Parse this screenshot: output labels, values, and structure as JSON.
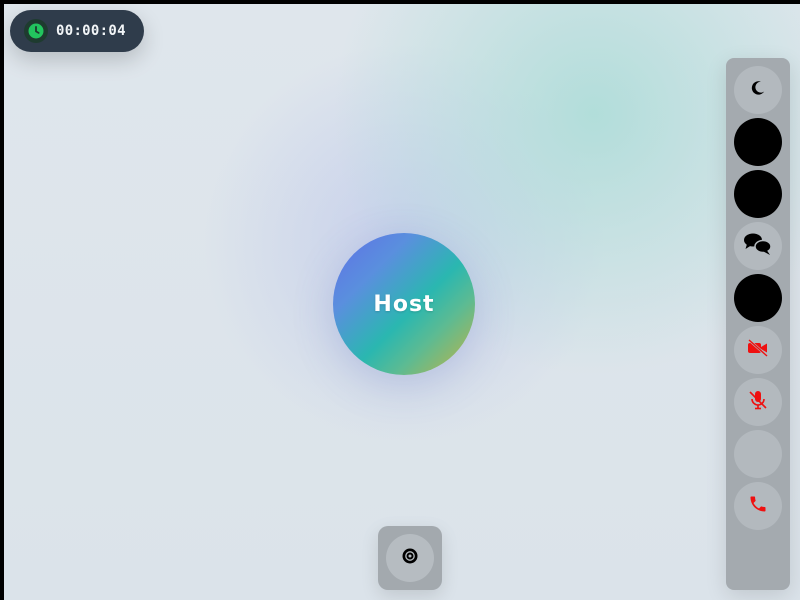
{
  "call": {
    "timer": "00:00:04",
    "participant_name": "Host"
  },
  "colors": {
    "timer_bg": "#2f3c4b",
    "timer_icon": "#22c55e",
    "danger": "#ef1010",
    "panel": "#a4aaaf"
  },
  "icons": {
    "timer": "clock-icon",
    "theme_toggle": "moon-icon",
    "chat": "chat-bubbles-icon",
    "camera_off": "video-off-icon",
    "mic_off": "mic-off-icon",
    "hang_up": "phone-icon",
    "dock": "record-icon"
  }
}
